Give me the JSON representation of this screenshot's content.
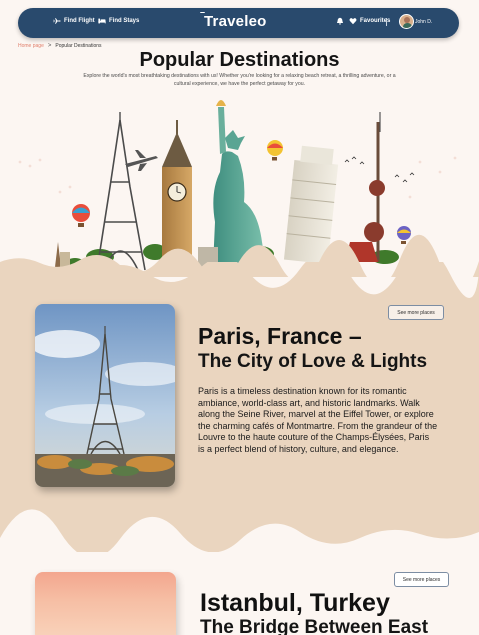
{
  "nav": {
    "find_flight": "Find Flight",
    "find_stays": "Find Stays",
    "logo": "Traveleo",
    "favourites": "Favourites",
    "user_name": "John D."
  },
  "breadcrumb": {
    "home": "Home page",
    "separator": ">",
    "current": "Popular Destinations"
  },
  "hero": {
    "title": "Popular Destinations",
    "subtitle": "Explore the world's most breathtaking destinations with us! Whether you're looking for a relaxing beach retreat, a thrilling adventure, or a cultural experience, we have the perfect getaway for you."
  },
  "destinations": [
    {
      "title": "Paris, France –",
      "tagline": "The City of Love & Lights",
      "description": "Paris is a timeless destination known for its romantic ambiance, world-class art, and historic landmarks. Walk along the Seine River, marvel at the Eiffel Tower, or explore the charming cafés of Montmartre. From the grandeur of the Louvre to the haute couture of the Champs-Élysées, Paris is a perfect blend of history, culture, and elegance.",
      "see_more": "See more places"
    },
    {
      "title": "Istanbul, Turkey",
      "tagline": "The Bridge Between East",
      "see_more": "See more places"
    }
  ],
  "colors": {
    "navbar": "#294a6d",
    "page_bg": "#fcf6f2",
    "section_bg": "#ead5bf",
    "breadcrumb_link": "#e0806d"
  },
  "icons": [
    "plane-icon",
    "bed-icon",
    "bell-icon",
    "heart-icon",
    "avatar"
  ]
}
